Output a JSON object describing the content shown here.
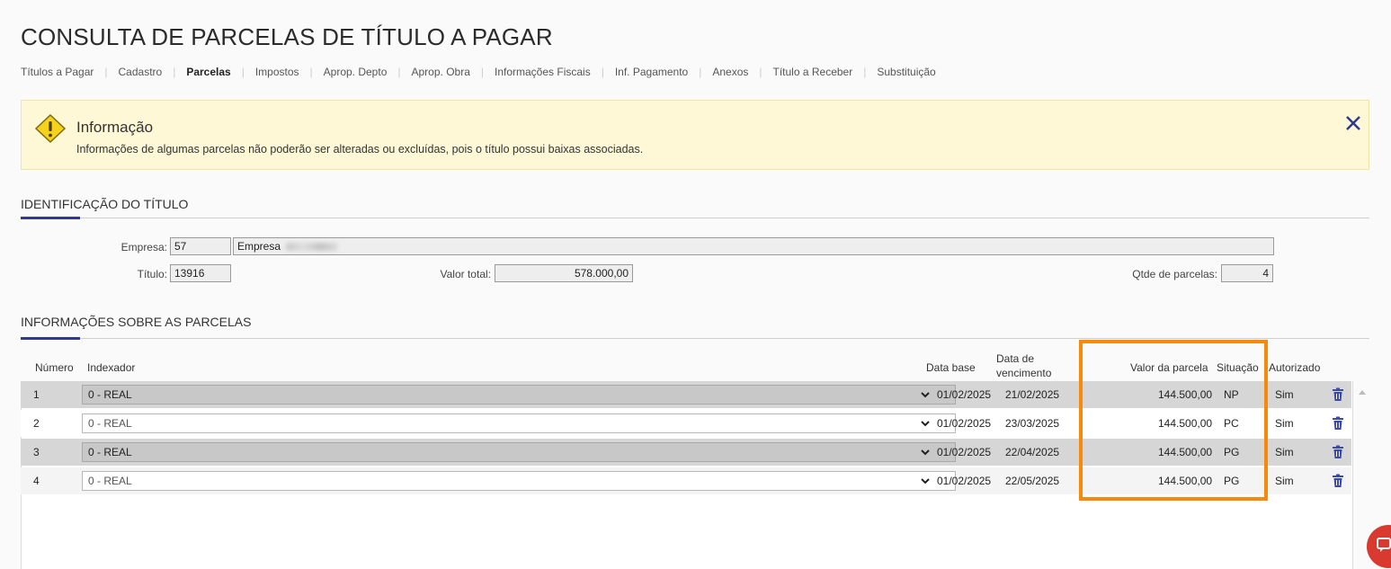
{
  "page": {
    "title": "CONSULTA DE PARCELAS DE TÍTULO A PAGAR"
  },
  "tabs": [
    {
      "label": "Títulos a Pagar",
      "active": false
    },
    {
      "label": "Cadastro",
      "active": false
    },
    {
      "label": "Parcelas",
      "active": true
    },
    {
      "label": "Impostos",
      "active": false
    },
    {
      "label": "Aprop. Depto",
      "active": false
    },
    {
      "label": "Aprop. Obra",
      "active": false
    },
    {
      "label": "Informações Fiscais",
      "active": false
    },
    {
      "label": "Inf. Pagamento",
      "active": false
    },
    {
      "label": "Anexos",
      "active": false
    },
    {
      "label": "Título a Receber",
      "active": false
    },
    {
      "label": "Substituição",
      "active": false
    }
  ],
  "info": {
    "title": "Informação",
    "message": "Informações de algumas parcelas não poderão ser alteradas ou excluídas, pois o título possui baixas associadas.",
    "icon": "warning-icon",
    "close_icon": "close-icon"
  },
  "identificacao": {
    "section_title": "IDENTIFICAÇÃO DO TÍTULO",
    "empresa_label": "Empresa:",
    "empresa_code": "57",
    "empresa_name": "Empresa",
    "titulo_label": "Título:",
    "titulo_value": "13916",
    "valor_total_label": "Valor total:",
    "valor_total_value": "578.000,00",
    "qtde_label": "Qtde de parcelas:",
    "qtde_value": "4"
  },
  "parcelas": {
    "section_title": "INFORMAÇÕES SOBRE AS PARCELAS",
    "columns": {
      "numero": "Número",
      "indexador": "Indexador",
      "data_base": "Data base",
      "data_venc_1": "Data de",
      "data_venc_2": "vencimento",
      "valor": "Valor da parcela",
      "situacao": "Situação",
      "autorizado": "Autorizado"
    },
    "rows": [
      {
        "numero": "1",
        "indexador": "0 - REAL",
        "data_base": "01/02/2025",
        "vencimento": "21/02/2025",
        "valor": "144.500,00",
        "situacao": "NP",
        "autorizado": "Sim"
      },
      {
        "numero": "2",
        "indexador": "0 - REAL",
        "data_base": "01/02/2025",
        "vencimento": "23/03/2025",
        "valor": "144.500,00",
        "situacao": "PC",
        "autorizado": "Sim"
      },
      {
        "numero": "3",
        "indexador": "0 - REAL",
        "data_base": "01/02/2025",
        "vencimento": "22/04/2025",
        "valor": "144.500,00",
        "situacao": "PG",
        "autorizado": "Sim"
      },
      {
        "numero": "4",
        "indexador": "0 - REAL",
        "data_base": "01/02/2025",
        "vencimento": "22/05/2025",
        "valor": "144.500,00",
        "situacao": "PG",
        "autorizado": "Sim"
      }
    ]
  },
  "colors": {
    "accent": "#2f3a8f",
    "highlight": "#f7890c",
    "info_bg": "#fff8d6",
    "chat": "#d93a2f"
  }
}
